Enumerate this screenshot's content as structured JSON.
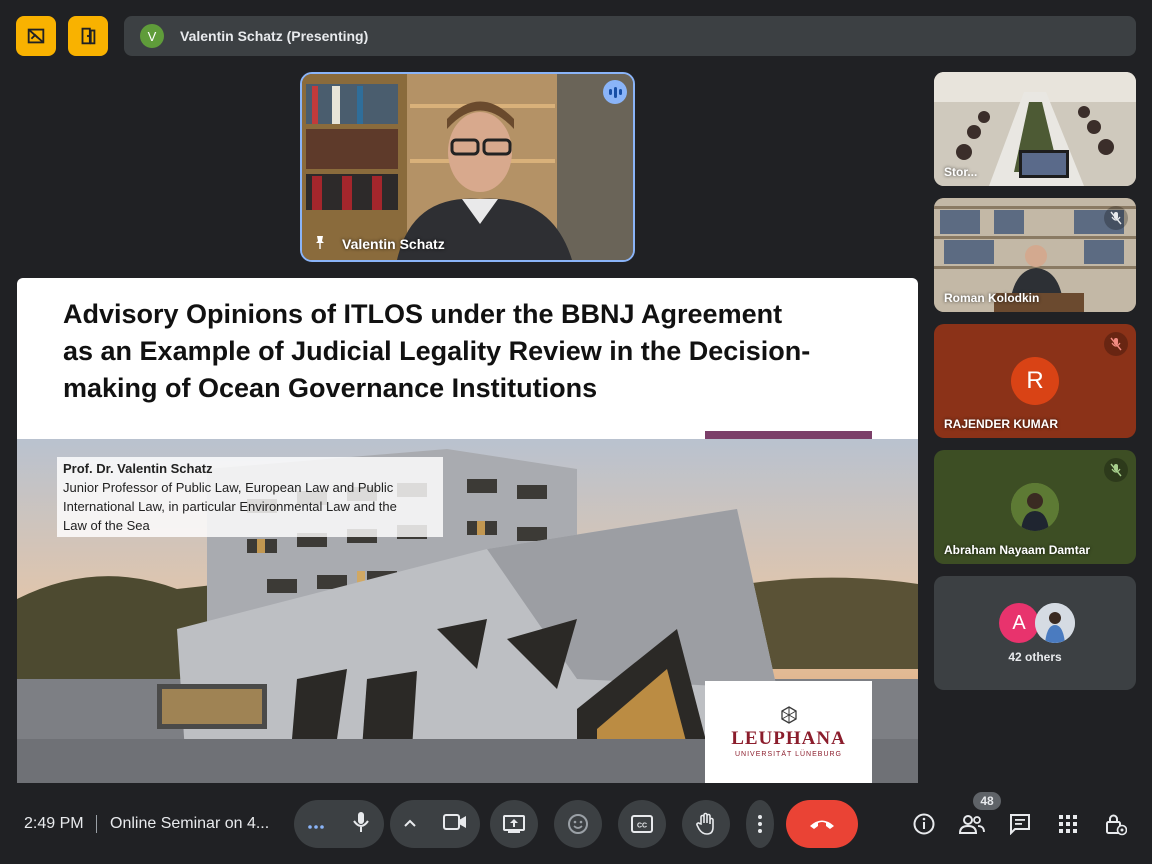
{
  "header": {
    "presenter_initial": "V",
    "presenting_text": "Valentin Schatz (Presenting)"
  },
  "presenter_tile": {
    "name": "Valentin Schatz"
  },
  "slide": {
    "title_lines": [
      "Advisory Opinions of ITLOS under the BBNJ Agreement",
      "as an Example of Judicial Legality Review in the Decision-",
      "making of Ocean Governance Institutions"
    ],
    "author_name": "Prof. Dr. Valentin Schatz",
    "author_desc_lines": [
      "Junior Professor of Public Law, European Law and Public",
      "International Law, in particular Environmental Law and the",
      "Law of the Sea"
    ],
    "logo_word": "LEUPHANA",
    "logo_sub": "UNIVERSITÄT LÜNEBURG"
  },
  "participants": [
    {
      "name": "Stor...",
      "muted": false
    },
    {
      "name": "Roman Kolodkin",
      "muted": true
    },
    {
      "name": "RAJENDER KUMAR",
      "initial": "R",
      "muted": true
    },
    {
      "name": "Abraham Nayaam Damtar",
      "muted": true
    }
  ],
  "others": {
    "initial": "A",
    "label": "42 others"
  },
  "bottom_bar": {
    "time": "2:49 PM",
    "meeting_title": "Online Seminar on 4...",
    "participant_count": "48"
  },
  "colors": {
    "background": "#202124",
    "accent_yellow": "#f9b200",
    "end_call_red": "#ea4335",
    "speaking_blue": "#8ab4f8",
    "rajender_tile": "#8b3218",
    "abraham_tile": "#3d4e24",
    "leuphana_red": "#8b1d2c"
  },
  "icons": [
    "no-visual-effects-icon",
    "door-exit-icon",
    "mic-icon",
    "camera-icon",
    "present-icon",
    "emoji-icon",
    "captions-icon",
    "raise-hand-icon",
    "more-options-icon",
    "end-call-icon",
    "info-icon",
    "people-icon",
    "chat-icon",
    "activities-icon",
    "host-controls-icon"
  ]
}
